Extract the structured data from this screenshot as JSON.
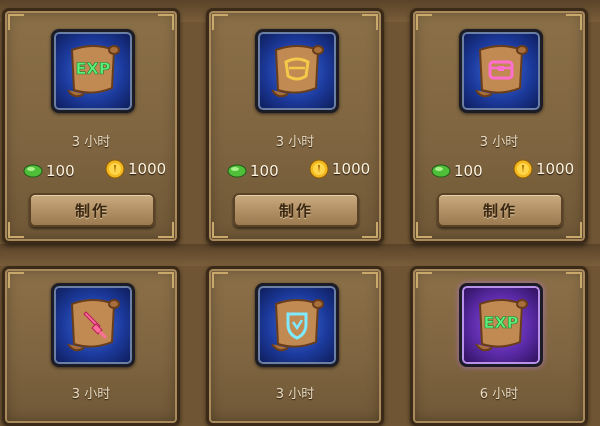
{
  "cards": [
    {
      "icon": "exp-scroll-icon",
      "duration": "3 小时",
      "gem_cost": "100",
      "coin_cost": "1000",
      "button": "制作"
    },
    {
      "icon": "gold-rune-scroll-icon",
      "duration": "3 小时",
      "gem_cost": "100",
      "coin_cost": "1000",
      "button": "制作"
    },
    {
      "icon": "chest-scroll-icon",
      "duration": "3 小时",
      "gem_cost": "100",
      "coin_cost": "1000",
      "button": "制作"
    },
    {
      "icon": "sword-scroll-icon",
      "duration": "3 小时"
    },
    {
      "icon": "shield-scroll-icon",
      "duration": "3 小时"
    },
    {
      "icon": "exp-scroll-purple-icon",
      "duration": "6 小时"
    }
  ],
  "colors": {
    "panel": "#8b7048",
    "frame_blue": "#1c3a9c",
    "frame_purple": "#5a2aa6",
    "button": "#b39166",
    "exp_rune": "#5cf07a",
    "gold_rune": "#f5c84a",
    "pink_rune": "#ff6fd0",
    "cyan_rune": "#7fe9ff"
  }
}
